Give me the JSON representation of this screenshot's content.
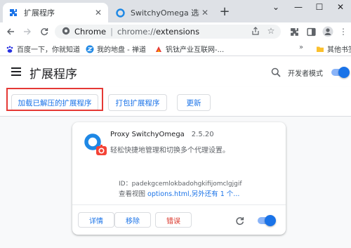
{
  "tabs": [
    {
      "title": "扩展程序",
      "icon": "puzzle-icon",
      "active": true
    },
    {
      "title": "SwitchyOmega 选项",
      "icon": "switchyomega-icon",
      "active": false
    }
  ],
  "omnibox": {
    "scheme_label": "Chrome",
    "url_scheme": "chrome://",
    "url_host": "extensions"
  },
  "bookmarks": [
    {
      "label": "百度一下，你就知道",
      "icon": "baidu-icon"
    },
    {
      "label": "我的地盘 - 禅道",
      "icon": "zentao-icon"
    },
    {
      "label": "钒钛产业互联网-...",
      "icon": "bookmark-icon"
    },
    {
      "label": "其他书签",
      "icon": "folder-icon"
    }
  ],
  "header": {
    "title": "扩展程序",
    "dev_mode_label": "开发者模式",
    "dev_mode_on": true
  },
  "dev_toolbar": {
    "load_unpacked": "加载已解压的扩展程序",
    "pack": "打包扩展程序",
    "update": "更新"
  },
  "extension": {
    "name": "Proxy SwitchyOmega",
    "version": "2.5.20",
    "description": "轻松快捷地管理和切换多个代理设置。",
    "id_line": "ID：padekgcemlokbadohgkifijomclgjgif",
    "views_prefix": "查看视图",
    "views_link": "options.html,另外还有 1 个...",
    "details_button": "详情",
    "remove_button": "移除",
    "errors_button": "错误",
    "enabled": true
  },
  "colors": {
    "accent": "#1a73e8",
    "highlight_border": "#e53935",
    "error_text": "#d93025"
  }
}
